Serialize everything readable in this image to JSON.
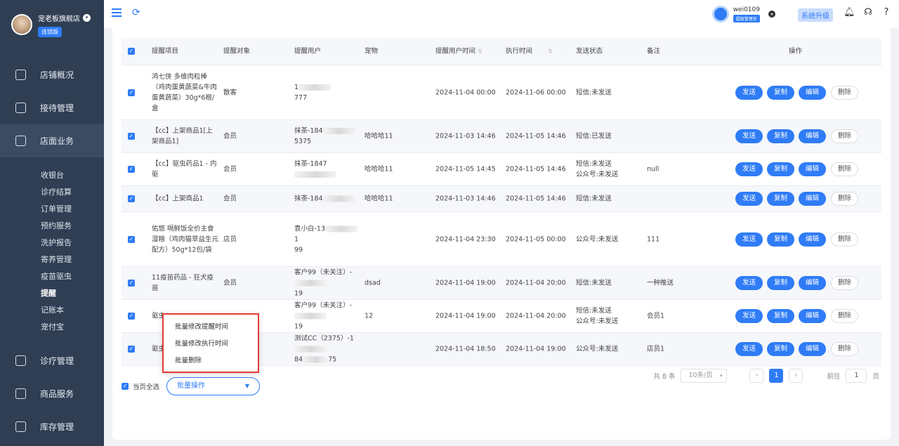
{
  "sidebar": {
    "store_name": "宠老板旗舰店",
    "store_badge": "连锁版",
    "nav": [
      {
        "label": "店铺概况",
        "icon": "monitor-icon"
      },
      {
        "label": "接待管理",
        "icon": "reception-icon"
      },
      {
        "label": "店面业务",
        "icon": "store-icon",
        "active": true
      },
      {
        "label": "诊疗管理",
        "icon": "clinic-icon"
      },
      {
        "label": "商品服务",
        "icon": "goods-icon"
      },
      {
        "label": "库存管理",
        "icon": "inventory-icon"
      }
    ],
    "sub": [
      "收银台",
      "诊疗结算",
      "订单管理",
      "预约服务",
      "洗护报告",
      "寄养管理",
      "疫苗驱虫",
      "提醒",
      "记账本",
      "宠付宝"
    ],
    "sub_active": "提醒"
  },
  "topbar": {
    "username": "wei0109",
    "role": "超级管理员",
    "upgrade": "系统升级"
  },
  "table": {
    "headers": [
      "提醒项目",
      "提醒对象",
      "提醒用户",
      "宠物",
      "提醒用户时间",
      "执行时间",
      "发送状态",
      "备注",
      "操作"
    ],
    "rows": [
      {
        "item": "鸿七侠 多维肉粒棒（鸡肉蛋黄蔬菜&牛肉蛋黄蔬菜）30g*6根/盒",
        "target": "散客",
        "user_a": "1",
        "user_b": "777",
        "pet": "",
        "remind_time": "2024-11-04 00:00",
        "exec_time": "2024-11-06 00:00",
        "status": "短信:未发送",
        "note": ""
      },
      {
        "item": "【cc】上架商品1[上架商品1]",
        "target": "会员",
        "user_a": "抹茶-184",
        "user_b": "5375",
        "pet": "哈哈哈11",
        "remind_time": "2024-11-03 14:46",
        "exec_time": "2024-11-05 14:46",
        "status": "短信:已发送",
        "note": ""
      },
      {
        "item": "【cc】驱虫药品1 - 内驱",
        "target": "会员",
        "user_a": "抹茶-1847",
        "user_b": "",
        "pet": "哈哈哈11",
        "remind_time": "2024-11-05 14:45",
        "exec_time": "2024-11-05 14:46",
        "status": "短信:未发送\n公众号:未发送",
        "note": "null"
      },
      {
        "item": "【cc】上架商品1",
        "target": "会员",
        "user_a": "抹茶-184",
        "user_b": "",
        "pet": "哈哈哈11",
        "remind_time": "2024-11-03 14:46",
        "exec_time": "2024-11-05 14:46",
        "status": "短信:未发送",
        "note": ""
      },
      {
        "item": "佑悠 嗝鲜饭全价主食湿粮（鸡肉猫草益生元配方）50g*12包/袋",
        "target": "店员",
        "user_a": "袁小白-13",
        "user_b": "1\n99",
        "pet": "",
        "remind_time": "2024-11-04 23:30",
        "exec_time": "2024-11-05 00:00",
        "status": "公众号:未发送",
        "note": "111"
      },
      {
        "item": "11疫苗药品 - 狂犬疫苗",
        "target": "会员",
        "user_a": "客户99（未关注）-",
        "user_b": "19",
        "pet": "dsad",
        "remind_time": "2024-11-04 19:00",
        "exec_time": "2024-11-04 20:00",
        "status": "短信:未发送",
        "note": "一种推送"
      },
      {
        "item": "驱虫",
        "target": "",
        "user_a": "客户99（未关注）-",
        "user_b": "19",
        "pet": "12",
        "remind_time": "2024-11-04 19:00",
        "exec_time": "2024-11-04 20:00",
        "status": "短信:未发送\n公众号:未发送",
        "note": "会员1"
      },
      {
        "item": "驱虫",
        "target": "",
        "user_a": "测试CC（2375）-1",
        "user_b": "84",
        "user_c": "75",
        "pet": "",
        "remind_time": "2024-11-04 18:50",
        "exec_time": "2024-11-04 19:00",
        "status": "公众号:未发送",
        "note": "店员1"
      }
    ],
    "actions": {
      "send": "发送",
      "copy": "复制",
      "edit": "编辑",
      "delete": "删除"
    }
  },
  "bulk": {
    "select_all": "当页全选",
    "button": "批量操作",
    "menu": [
      "批量修改提醒时间",
      "批量修改执行时间",
      "批量删除"
    ]
  },
  "pager": {
    "total": "共 8 条",
    "page_size": "10条/页",
    "current": "1",
    "goto_label": "前往",
    "goto_value": "1",
    "goto_suffix": "页"
  }
}
